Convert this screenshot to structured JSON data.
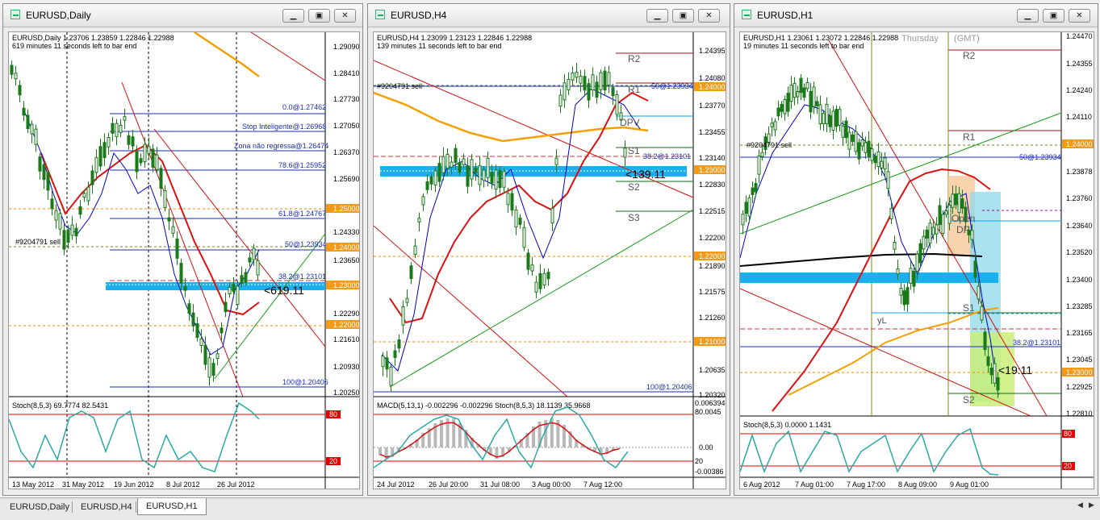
{
  "windows": [
    {
      "title": "EURUSD,Daily",
      "info_line1": "EURUSD,Daily  1.23706 1.23859 1.22846 1.22988",
      "info_line2": "619 minutes 11 seconds left to bar end",
      "countdown": "<619.11",
      "price_ticks": [
        "1.29090",
        "1.28410",
        "1.27730",
        "1.27050",
        "1.26370",
        "1.25690",
        "1.25000",
        "1.24330",
        "1.24000",
        "1.23650",
        "1.23000",
        "1.22290",
        "1.22000",
        "1.21610",
        "1.20930",
        "1.20250"
      ],
      "levels": [
        "0.0@1.27462",
        "Stop Inteligente@1.26968",
        "Zona não regressa@1.26474",
        "78.6@1.25952",
        "61.8@1.24767",
        "50@1.23934",
        "38.2@1.23101",
        "100@1.20406"
      ],
      "order_label": "#9204791 sell",
      "sub_label": "Stoch(8,5,3) 69.7774 82.5431",
      "sub_ticks": [
        "80",
        "20"
      ],
      "time_ticks": [
        "13 May 2012",
        "31 May 2012",
        "19 Jun 2012",
        "8 Jul 2012",
        "26 Jul 2012"
      ]
    },
    {
      "title": "EURUSD,H4",
      "info_line1": "EURUSD,H4  1.23099 1.23123 1.22846 1.22988",
      "info_line2": "139 minutes 11 seconds left to bar end",
      "countdown": "<139.11",
      "price_ticks": [
        "1.24395",
        "1.24080",
        "1.24000",
        "1.23770",
        "1.23455",
        "1.23140",
        "1.23000",
        "1.22830",
        "1.22515",
        "1.22200",
        "1.22000",
        "1.21890",
        "1.21575",
        "1.21260",
        "1.21000",
        "1.20635",
        "1.20320"
      ],
      "levels": [
        "R2",
        "R1",
        "50@1.23934",
        "DPV",
        "S1",
        "38.2@1.23101",
        "S2",
        "S3",
        "100@1.20406"
      ],
      "order_label": "#9204791 sell",
      "sub_label": "MACD(5,13,1) -0.002296 -0.002296  Stoch(8,5,3) 18.1139 35.9668",
      "sub_ticks": [
        "0.006394",
        "80.0045",
        "0.00",
        "20",
        "-0.00386"
      ],
      "time_ticks": [
        "24 Jul 2012",
        "26 Jul 20:00",
        "31 Jul 08:00",
        "3 Aug 00:00",
        "7 Aug 12:00"
      ]
    },
    {
      "title": "EURUSD,H1",
      "info_line1": "EURUSD,H1  1.23061 1.23072 1.22846 1.22988",
      "info_line2": "19 minutes 11 seconds left to bar end",
      "day_label": "Thursday",
      "gmt_label": "(GMT)",
      "countdown": "<19:11",
      "price_ticks": [
        "1.24470",
        "1.24355",
        "1.24240",
        "1.24110",
        "1.24000",
        "1.23878",
        "1.23760",
        "1.23640",
        "1.23520",
        "1.23400",
        "1.23285",
        "1.23165",
        "1.23045",
        "1.23000",
        "1.22925",
        "1.22810"
      ],
      "levels": [
        "R2",
        "R1",
        "50@1.23934",
        "Open",
        "DP",
        "S1",
        "yL",
        "38.2@1.23101",
        "S2"
      ],
      "order_label": "#9204791 sell",
      "sub_label": "Stoch(8,5,3) 0.0000 1.1431",
      "sub_ticks": [
        "80",
        "20"
      ],
      "time_ticks": [
        "6 Aug 2012",
        "7 Aug 01:00",
        "7 Aug 17:00",
        "8 Aug 09:00",
        "9 Aug 01:00"
      ]
    }
  ],
  "tabs": [
    "EURUSD,Daily",
    "EURUSD,H4",
    "EURUSD,H1"
  ],
  "active_tab": "EURUSD,H1",
  "colors": {
    "bull": "#1a7a1a",
    "bear": "#1a7a1a",
    "ma_red": "#dd1111",
    "ma_orange": "#f5a000",
    "ma_blue": "#0000cc",
    "zone": "#1ab0ee",
    "grid": "#cfcfcf",
    "highlight": "#f39a19"
  }
}
